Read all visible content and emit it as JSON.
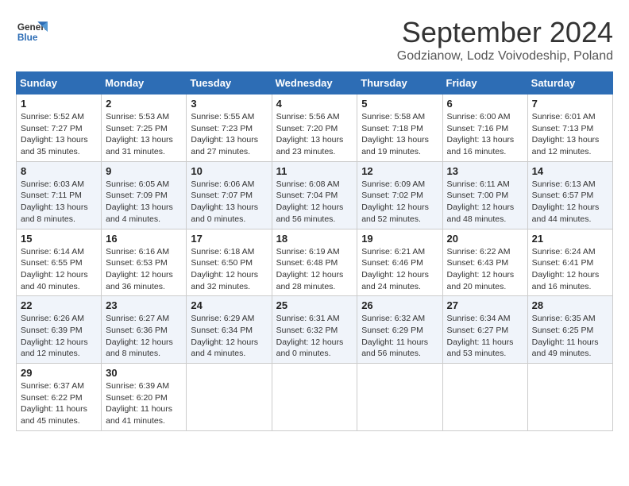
{
  "header": {
    "logo_line1": "General",
    "logo_line2": "Blue",
    "month_year": "September 2024",
    "location": "Godzianow, Lodz Voivodeship, Poland"
  },
  "weekdays": [
    "Sunday",
    "Monday",
    "Tuesday",
    "Wednesday",
    "Thursday",
    "Friday",
    "Saturday"
  ],
  "weeks": [
    [
      {
        "day": "1",
        "info": "Sunrise: 5:52 AM\nSunset: 7:27 PM\nDaylight: 13 hours\nand 35 minutes."
      },
      {
        "day": "2",
        "info": "Sunrise: 5:53 AM\nSunset: 7:25 PM\nDaylight: 13 hours\nand 31 minutes."
      },
      {
        "day": "3",
        "info": "Sunrise: 5:55 AM\nSunset: 7:23 PM\nDaylight: 13 hours\nand 27 minutes."
      },
      {
        "day": "4",
        "info": "Sunrise: 5:56 AM\nSunset: 7:20 PM\nDaylight: 13 hours\nand 23 minutes."
      },
      {
        "day": "5",
        "info": "Sunrise: 5:58 AM\nSunset: 7:18 PM\nDaylight: 13 hours\nand 19 minutes."
      },
      {
        "day": "6",
        "info": "Sunrise: 6:00 AM\nSunset: 7:16 PM\nDaylight: 13 hours\nand 16 minutes."
      },
      {
        "day": "7",
        "info": "Sunrise: 6:01 AM\nSunset: 7:13 PM\nDaylight: 13 hours\nand 12 minutes."
      }
    ],
    [
      {
        "day": "8",
        "info": "Sunrise: 6:03 AM\nSunset: 7:11 PM\nDaylight: 13 hours\nand 8 minutes."
      },
      {
        "day": "9",
        "info": "Sunrise: 6:05 AM\nSunset: 7:09 PM\nDaylight: 13 hours\nand 4 minutes."
      },
      {
        "day": "10",
        "info": "Sunrise: 6:06 AM\nSunset: 7:07 PM\nDaylight: 13 hours\nand 0 minutes."
      },
      {
        "day": "11",
        "info": "Sunrise: 6:08 AM\nSunset: 7:04 PM\nDaylight: 12 hours\nand 56 minutes."
      },
      {
        "day": "12",
        "info": "Sunrise: 6:09 AM\nSunset: 7:02 PM\nDaylight: 12 hours\nand 52 minutes."
      },
      {
        "day": "13",
        "info": "Sunrise: 6:11 AM\nSunset: 7:00 PM\nDaylight: 12 hours\nand 48 minutes."
      },
      {
        "day": "14",
        "info": "Sunrise: 6:13 AM\nSunset: 6:57 PM\nDaylight: 12 hours\nand 44 minutes."
      }
    ],
    [
      {
        "day": "15",
        "info": "Sunrise: 6:14 AM\nSunset: 6:55 PM\nDaylight: 12 hours\nand 40 minutes."
      },
      {
        "day": "16",
        "info": "Sunrise: 6:16 AM\nSunset: 6:53 PM\nDaylight: 12 hours\nand 36 minutes."
      },
      {
        "day": "17",
        "info": "Sunrise: 6:18 AM\nSunset: 6:50 PM\nDaylight: 12 hours\nand 32 minutes."
      },
      {
        "day": "18",
        "info": "Sunrise: 6:19 AM\nSunset: 6:48 PM\nDaylight: 12 hours\nand 28 minutes."
      },
      {
        "day": "19",
        "info": "Sunrise: 6:21 AM\nSunset: 6:46 PM\nDaylight: 12 hours\nand 24 minutes."
      },
      {
        "day": "20",
        "info": "Sunrise: 6:22 AM\nSunset: 6:43 PM\nDaylight: 12 hours\nand 20 minutes."
      },
      {
        "day": "21",
        "info": "Sunrise: 6:24 AM\nSunset: 6:41 PM\nDaylight: 12 hours\nand 16 minutes."
      }
    ],
    [
      {
        "day": "22",
        "info": "Sunrise: 6:26 AM\nSunset: 6:39 PM\nDaylight: 12 hours\nand 12 minutes."
      },
      {
        "day": "23",
        "info": "Sunrise: 6:27 AM\nSunset: 6:36 PM\nDaylight: 12 hours\nand 8 minutes."
      },
      {
        "day": "24",
        "info": "Sunrise: 6:29 AM\nSunset: 6:34 PM\nDaylight: 12 hours\nand 4 minutes."
      },
      {
        "day": "25",
        "info": "Sunrise: 6:31 AM\nSunset: 6:32 PM\nDaylight: 12 hours\nand 0 minutes."
      },
      {
        "day": "26",
        "info": "Sunrise: 6:32 AM\nSunset: 6:29 PM\nDaylight: 11 hours\nand 56 minutes."
      },
      {
        "day": "27",
        "info": "Sunrise: 6:34 AM\nSunset: 6:27 PM\nDaylight: 11 hours\nand 53 minutes."
      },
      {
        "day": "28",
        "info": "Sunrise: 6:35 AM\nSunset: 6:25 PM\nDaylight: 11 hours\nand 49 minutes."
      }
    ],
    [
      {
        "day": "29",
        "info": "Sunrise: 6:37 AM\nSunset: 6:22 PM\nDaylight: 11 hours\nand 45 minutes."
      },
      {
        "day": "30",
        "info": "Sunrise: 6:39 AM\nSunset: 6:20 PM\nDaylight: 11 hours\nand 41 minutes."
      },
      null,
      null,
      null,
      null,
      null
    ]
  ]
}
